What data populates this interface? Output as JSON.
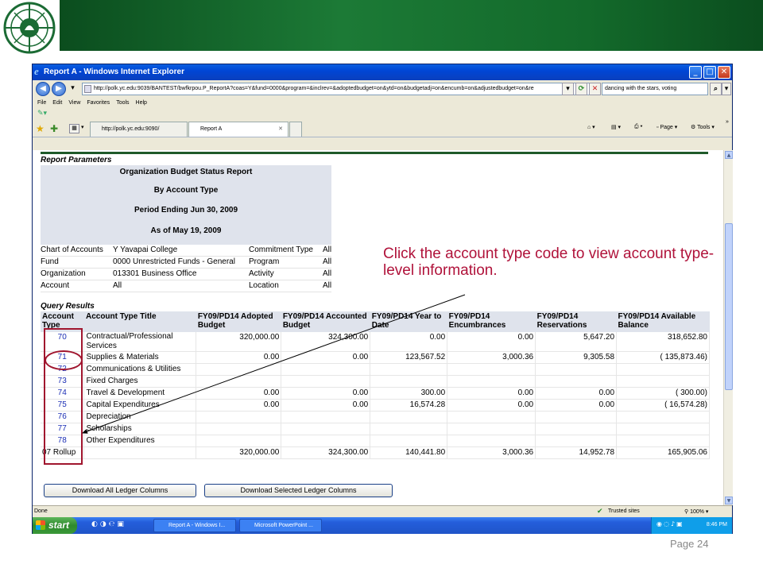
{
  "window": {
    "title": "Report A - Windows Internet Explorer",
    "address": "http://polk.yc.edu:9039/BANTEST/bwfkrpou.P_ReportA?coas=Y&fund=0000&program=&inclrev=&adoptedbudget=on&ytd=on&budgetadj=on&encumb=on&adjustedbudget=on&re",
    "search_value": "dancing with the stars, voting",
    "menu": [
      "File",
      "Edit",
      "View",
      "Favorites",
      "Tools",
      "Help"
    ],
    "tabs": [
      "http://polk.yc.edu:9090/",
      "Report A"
    ],
    "command_bar": {
      "page": "Page",
      "tools": "Tools"
    }
  },
  "report": {
    "params_title": "Report Parameters",
    "header_lines": [
      "Organization Budget Status Report",
      "By Account Type",
      "Period Ending Jun 30, 2009",
      "As of May 19, 2009"
    ],
    "params": [
      {
        "label": "Chart of Accounts",
        "value": "Y Yavapai College",
        "label2": "Commitment Type",
        "value2": "All"
      },
      {
        "label": "Fund",
        "value": "0000 Unrestricted Funds - General",
        "label2": "Program",
        "value2": "All"
      },
      {
        "label": "Organization",
        "value": "013301 Business Office",
        "label2": "Activity",
        "value2": "All"
      },
      {
        "label": "Account",
        "value": "All",
        "label2": "Location",
        "value2": "All"
      }
    ],
    "results_title": "Query Results",
    "columns": [
      "Account Type",
      "Account Type Title",
      "FY09/PD14 Adopted Budget",
      "FY09/PD14 Accounted Budget",
      "FY09/PD14 Year to Date",
      "FY09/PD14 Encumbrances",
      "FY09/PD14 Reservations",
      "FY09/PD14 Available Balance"
    ],
    "rows": [
      [
        "70",
        "Contractual/Professional Services",
        "320,000.00",
        "324,300.00",
        "0.00",
        "0.00",
        "5,647.20",
        "318,652.80"
      ],
      [
        "71",
        "Supplies & Materials",
        "0.00",
        "0.00",
        "123,567.52",
        "3,000.36",
        "9,305.58",
        "( 135,873.46)"
      ],
      [
        "72",
        "Communications & Utilities",
        "",
        "",
        "",
        "",
        "",
        ""
      ],
      [
        "73",
        "Fixed Charges",
        "",
        "",
        "",
        "",
        "",
        ""
      ],
      [
        "74",
        "Travel & Development",
        "0.00",
        "0.00",
        "300.00",
        "0.00",
        "0.00",
        "( 300.00)"
      ],
      [
        "75",
        "Capital Expenditures",
        "0.00",
        "0.00",
        "16,574.28",
        "0.00",
        "0.00",
        "( 16,574.28)"
      ],
      [
        "76",
        "Depreciation",
        "",
        "",
        "",
        "",
        "",
        ""
      ],
      [
        "77",
        "Scholarships",
        "",
        "",
        "",
        "",
        "",
        ""
      ],
      [
        "78",
        "Other Expenditures",
        "",
        "",
        "",
        "",
        "",
        ""
      ],
      [
        "07 Rollup",
        "",
        "320,000.00",
        "324,300.00",
        "140,441.80",
        "3,000.36",
        "14,952.78",
        "165,905.06"
      ]
    ],
    "download_all": "Download All Ledger Columns",
    "download_selected": "Download Selected Ledger Columns"
  },
  "status": {
    "left": "Done",
    "zone": "Trusted sites",
    "zoom": "100%"
  },
  "taskbar": {
    "start": "start",
    "tasks": [
      "Report A - Windows I...",
      "Microsoft PowerPoint ..."
    ],
    "time": "8:46 PM"
  },
  "callout": "Click the account type code to view account type-level information.",
  "page_number": "Page 24",
  "colors": {
    "banner": "#136a2b",
    "callout": "#b0123a",
    "highlight": "#a0152e"
  }
}
